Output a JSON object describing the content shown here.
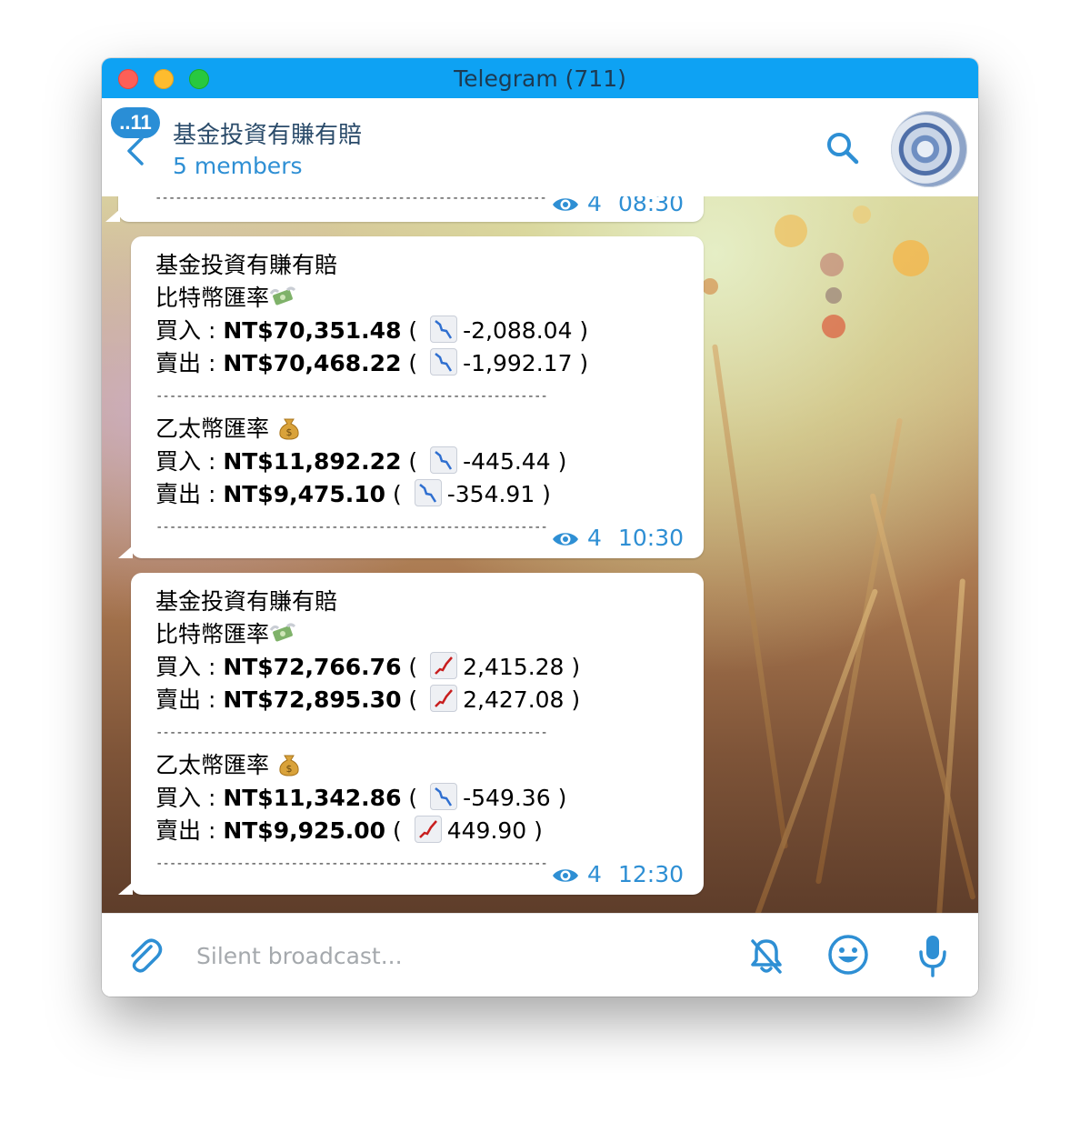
{
  "window": {
    "title": "Telegram (711)"
  },
  "header": {
    "badge": "..11",
    "chat_title": "基金投資有賺有賠",
    "chat_subtitle": "5 members"
  },
  "messages": [
    {
      "lines": [],
      "views": "4",
      "time": "08:30"
    },
    {
      "channel": "基金投資有賺有賠",
      "btc_heading": "比特幣匯率",
      "btc_buy_label": "買入 : ",
      "btc_buy_price": "NT$70,351.48",
      "btc_buy_trend": "down",
      "btc_buy_change": "-2,088.04",
      "btc_sell_label": "賣出 : ",
      "btc_sell_price": "NT$70,468.22",
      "btc_sell_trend": "down",
      "btc_sell_change": "-1,992.17",
      "separator": "----------------------------------------------------------",
      "eth_heading": "乙太幣匯率",
      "eth_buy_label": "買入 : ",
      "eth_buy_price": "NT$11,892.22",
      "eth_buy_trend": "down",
      "eth_buy_change": "-445.44",
      "eth_sell_label": "賣出 : ",
      "eth_sell_price": "NT$9,475.10",
      "eth_sell_trend": "down",
      "eth_sell_change": "-354.91",
      "views": "4",
      "time": "10:30"
    },
    {
      "channel": "基金投資有賺有賠",
      "btc_heading": "比特幣匯率",
      "btc_buy_label": "買入 : ",
      "btc_buy_price": "NT$72,766.76",
      "btc_buy_trend": "up",
      "btc_buy_change": "2,415.28",
      "btc_sell_label": "賣出 : ",
      "btc_sell_price": "NT$72,895.30",
      "btc_sell_trend": "up",
      "btc_sell_change": "2,427.08",
      "separator": "----------------------------------------------------------",
      "eth_heading": "乙太幣匯率",
      "eth_buy_label": "買入 : ",
      "eth_buy_price": "NT$11,342.86",
      "eth_buy_trend": "down",
      "eth_buy_change": "-549.36",
      "eth_sell_label": "賣出 : ",
      "eth_sell_price": "NT$9,925.00",
      "eth_sell_trend": "up",
      "eth_sell_change": "449.90",
      "views": "4",
      "time": "12:30"
    }
  ],
  "footer": {
    "placeholder": "Silent broadcast..."
  },
  "colors": {
    "titlebar": "#0ea2f3",
    "accent": "#2e8fd4",
    "badge": "#2a8ed6",
    "trend_down": "#2f6fd0",
    "trend_up": "#c81e1e"
  }
}
